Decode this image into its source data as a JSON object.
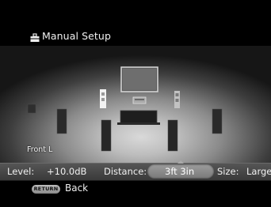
{
  "header": {
    "title": "Manual Setup",
    "title_icon": "toolbox-icon"
  },
  "stage": {
    "selected_speaker_label": "Front L",
    "speakers": [
      {
        "name": "speaker-left-far"
      },
      {
        "name": "speaker-front-l"
      },
      {
        "name": "speaker-center"
      },
      {
        "name": "speaker-front-r"
      },
      {
        "name": "speaker-right-far"
      },
      {
        "name": "speaker-surround-l"
      },
      {
        "name": "speaker-surround-r"
      },
      {
        "name": "speaker-rear-r"
      }
    ]
  },
  "settings": {
    "level_label": "Level:",
    "level_value": "+10.0dB",
    "distance_label": "Distance:",
    "distance_value": "3ft  3in",
    "size_label": "Size:",
    "size_value": "Large"
  },
  "footer": {
    "return_button_label": "RETURN",
    "back_label": "Back"
  }
}
